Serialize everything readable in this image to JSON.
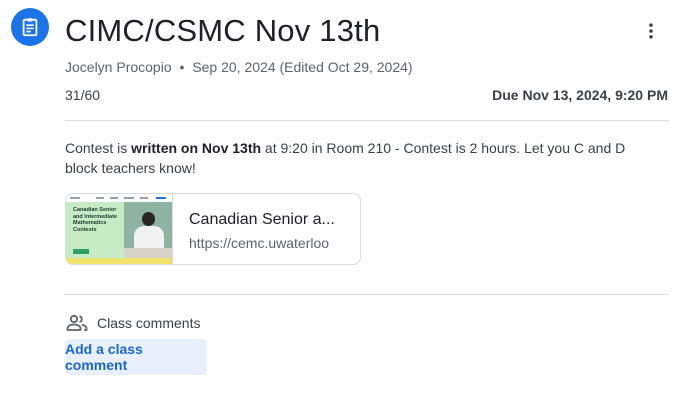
{
  "assignment": {
    "icon": "assignment-icon",
    "title": "CIMC/CSMC Nov 13th",
    "author": "Jocelyn Procopio",
    "separator": "•",
    "posted": "Sep 20, 2024",
    "edited": "(Edited Oct 29, 2024)",
    "points": "31/60",
    "due": "Due Nov 13, 2024, 9:20 PM"
  },
  "description": {
    "part1": "Contest is ",
    "bold": "written on Nov 13th",
    "part2": " at 9:20 in Room 210  - Contest is 2 hours.  Let you C and D block teachers know!"
  },
  "attachment": {
    "thumb_text": "Canadian Senior and Intermediate Mathematics Contests",
    "title": "Canadian Senior a...",
    "url": "https://cemc.uwaterloo"
  },
  "comments": {
    "icon": "people-icon",
    "header": "Class comments",
    "add_label": "Add a class comment"
  },
  "menu": {
    "icon": "more-vert-icon"
  },
  "colors": {
    "accent": "#1a73e8",
    "link": "#1967d2",
    "button_bg": "#e8f0fe",
    "divider": "#dadce0"
  }
}
